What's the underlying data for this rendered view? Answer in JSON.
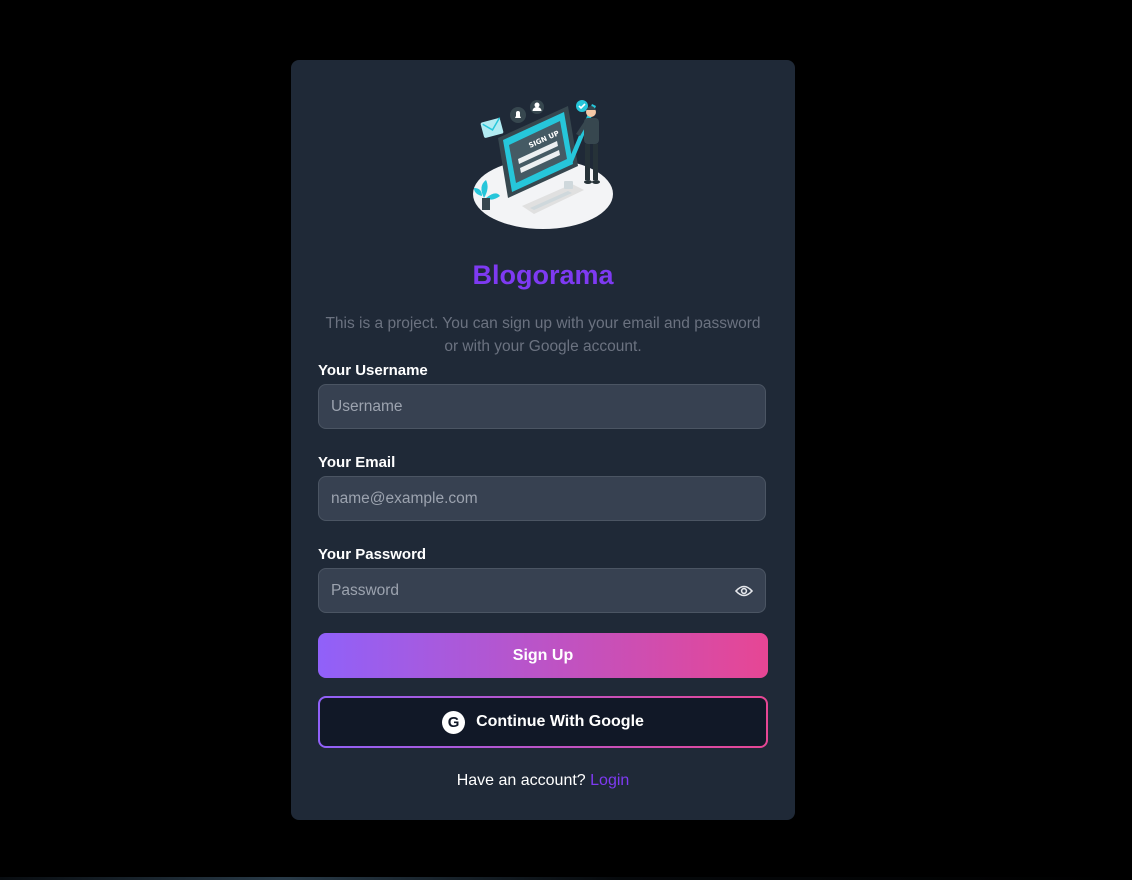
{
  "brand": {
    "title": "Blogorama",
    "subtitle": "This is a project. You can sign up with your email and password or with your Google account.",
    "illustration_text": "SIGN UP"
  },
  "form": {
    "username": {
      "label": "Your Username",
      "placeholder": "Username",
      "value": ""
    },
    "email": {
      "label": "Your Email",
      "placeholder": "name@example.com",
      "value": ""
    },
    "password": {
      "label": "Your Password",
      "placeholder": "Password",
      "value": "",
      "toggle_icon": "eye-icon"
    }
  },
  "actions": {
    "signup_label": "Sign Up",
    "google_label": "Continue With Google",
    "google_icon": "google-icon"
  },
  "footer": {
    "prompt": "Have an account?",
    "login_link": "Login"
  },
  "colors": {
    "page_bg": "#000000",
    "card_bg": "#1f2937",
    "input_bg": "#374151",
    "brand_purple": "#7e3af2",
    "gradient_start": "#9061f9",
    "gradient_end": "#e74694",
    "subtitle_gray": "#6b7280"
  }
}
